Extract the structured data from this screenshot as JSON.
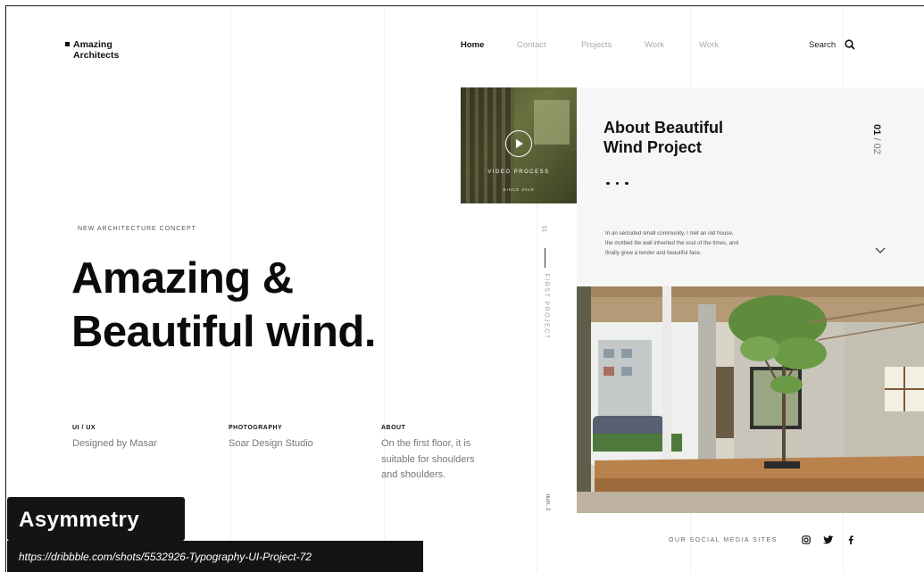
{
  "logo": {
    "line1": "Amazing",
    "line2": "Architects"
  },
  "nav": {
    "items": [
      "Home",
      "Contact",
      "Projects",
      "Work",
      "Work"
    ],
    "active": "Home",
    "search_label": "Search",
    "search_icon": "search-icon"
  },
  "video": {
    "label": "VIDEO PROCESS",
    "sub": "SINCE 2019",
    "icon": "play-icon"
  },
  "panel": {
    "title_line1": "About Beautiful",
    "title_line2": "Wind Project",
    "page_current": "01",
    "page_sep": "/",
    "page_total": "02",
    "desc_line1": "In an secluded small community, I met an old house,",
    "desc_line2": "the mottled tile wall inherited the soul of the times, and",
    "desc_line3": "finally grew a tender and beautiful face.",
    "chevron_icon": "chevron-down-icon"
  },
  "side": {
    "number": "01",
    "label": "FIRST PROJECT",
    "bottom": "num. 2"
  },
  "hero": {
    "kicker": "NEW ARCHITECTURE CONCEPT",
    "line1": "Amazing &",
    "line2": "Beautiful wind."
  },
  "info": [
    {
      "heading": "UI / UX",
      "text": "Designed by Masar"
    },
    {
      "heading": "PHOTOGRAPHY",
      "text": "Soar Design Studio"
    },
    {
      "heading": "ABOUT",
      "line1": "On the first floor, it is",
      "line2": "suitable for shoulders",
      "line3": "and shoulders."
    }
  ],
  "social": {
    "label": "OUR SOCIAL MEDIA SITES",
    "icons": [
      "instagram-icon",
      "twitter-icon",
      "facebook-icon"
    ]
  },
  "caption": {
    "tag": "Asymmetry",
    "url": "https://dribbble.com/shots/5532926-Typography-UI-Project-72"
  }
}
